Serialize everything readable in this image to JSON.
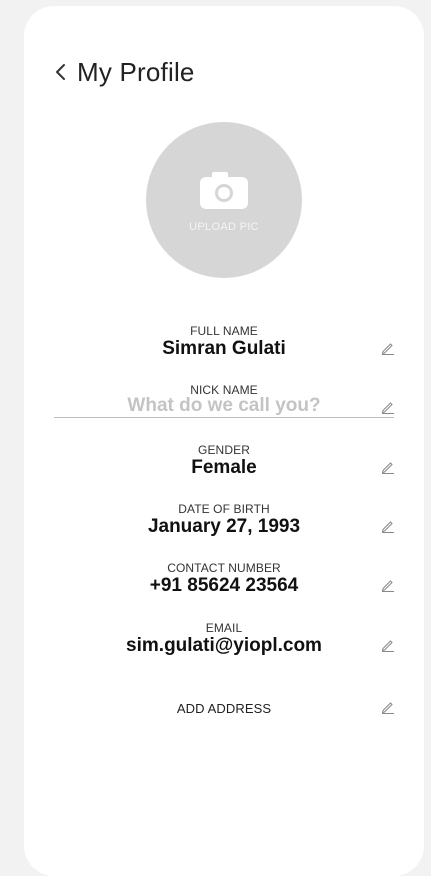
{
  "header": {
    "title": "My Profile",
    "back_icon": "chevron-left-icon"
  },
  "avatar": {
    "upload_label": "UPLOAD PIC",
    "icon": "camera-icon"
  },
  "fields": [
    {
      "label": "FULL NAME",
      "value": "Simran Gulati"
    },
    {
      "label": "NICK NAME",
      "value": "",
      "placeholder": "What do we call you?"
    },
    {
      "label": "GENDER",
      "value": "Female"
    },
    {
      "label": "DATE OF BIRTH",
      "value": "January 27, 1993"
    },
    {
      "label": "CONTACT NUMBER",
      "value": "+91 85624 23564"
    },
    {
      "label": "EMAIL",
      "value": "sim.gulati@yiopl.com"
    }
  ],
  "add_address": {
    "label": "ADD ADDRESS"
  },
  "icons": {
    "edit": "pencil-icon"
  },
  "colors": {
    "background": "#f2f2f2",
    "card": "#ffffff",
    "avatar": "#d6d6d6",
    "placeholder": "#c4c4c4"
  }
}
